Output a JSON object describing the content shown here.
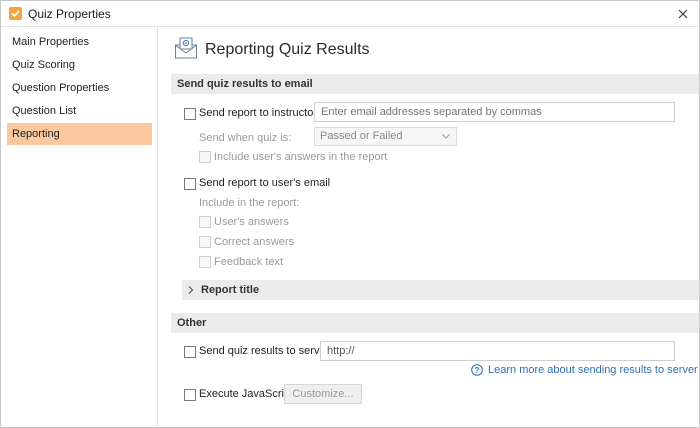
{
  "window": {
    "title": "Quiz Properties"
  },
  "sidebar": {
    "items": [
      {
        "label": "Main Properties",
        "active": false
      },
      {
        "label": "Quiz Scoring",
        "active": false
      },
      {
        "label": "Question Properties",
        "active": false
      },
      {
        "label": "Question List",
        "active": false
      },
      {
        "label": "Reporting",
        "active": true
      }
    ]
  },
  "page": {
    "title": "Reporting Quiz Results",
    "icon": "envelope-report-icon"
  },
  "email_section": {
    "header": "Send quiz results to email",
    "instructor": {
      "label": "Send report to instructor:",
      "checked": false,
      "placeholder": "Enter email addresses separated by commas",
      "send_when_label": "Send when quiz is:",
      "send_when_value": "Passed or Failed",
      "include_answers_label": "Include user's answers in the report"
    },
    "user": {
      "label": "Send report to user's email",
      "checked": false,
      "include_label": "Include in the report:",
      "options": [
        "User's answers",
        "Correct answers",
        "Feedback text"
      ]
    },
    "report_title": "Report title"
  },
  "other_section": {
    "header": "Other",
    "server": {
      "label": "Send quiz results to server:",
      "checked": false,
      "value": "http://"
    },
    "help_link": "Learn more about sending results to server",
    "javascript": {
      "label": "Execute JavaScript",
      "checked": false,
      "button": "Customize..."
    }
  },
  "colors": {
    "accent": "#fcc8a0",
    "link": "#2d6fb8",
    "app_icon": "#f5a53a"
  }
}
